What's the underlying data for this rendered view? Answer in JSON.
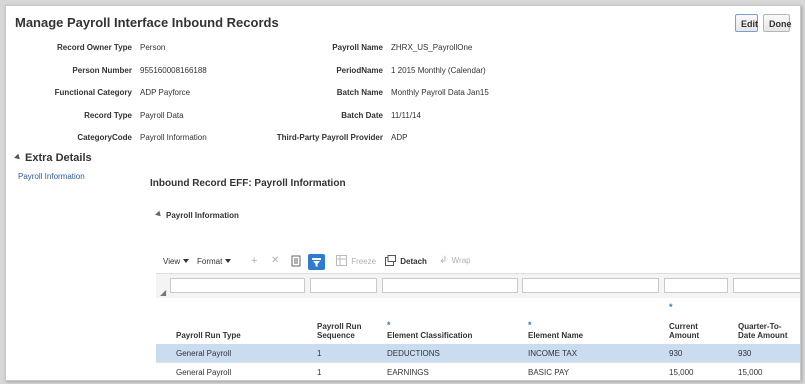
{
  "page": {
    "title": "Manage Payroll Interface Inbound Records",
    "edit_label": "Edit",
    "done_label": "Done"
  },
  "left_fields": [
    {
      "label": "Record Owner Type",
      "value": "Person"
    },
    {
      "label": "Person Number",
      "value": "955160008166188"
    },
    {
      "label": "Functional Category",
      "value": "ADP Payforce"
    },
    {
      "label": "Record Type",
      "value": "Payroll Data"
    },
    {
      "label": "CategoryCode",
      "value": "Payroll Information"
    }
  ],
  "right_fields": [
    {
      "label": "Payroll Name",
      "value": "ZHRX_US_PayrollOne"
    },
    {
      "label": "PeriodName",
      "value": "1 2015 Monthly (Calendar)"
    },
    {
      "label": "Batch Name",
      "value": "Monthly Payroll Data Jan15"
    },
    {
      "label": "Batch Date",
      "value": "11/11/14"
    },
    {
      "label": "Third-Party Payroll Provider",
      "value": "ADP"
    }
  ],
  "extra": {
    "header": "Extra Details",
    "link": "Payroll Information",
    "eff_title": "Inbound Record EFF: Payroll Information",
    "sub_header": "Payroll Information"
  },
  "toolbar": {
    "view": "View",
    "format": "Format",
    "freeze": "Freeze",
    "detach": "Detach",
    "wrap": "Wrap"
  },
  "table": {
    "columns": [
      {
        "label1": "Payroll Run Type",
        "label2": "",
        "required": false
      },
      {
        "label1": "Payroll Run",
        "label2": "Sequence",
        "required": false
      },
      {
        "label1": "Element Classification",
        "label2": "",
        "required": true
      },
      {
        "label1": "Element Name",
        "label2": "",
        "required": true
      },
      {
        "label1": "Current",
        "label2": "Amount",
        "required": true
      },
      {
        "label1": "Quarter-To-",
        "label2": "Date Amount",
        "required": false
      }
    ],
    "rows": [
      {
        "cells": [
          "General Payroll",
          "1",
          "DEDUCTIONS",
          "INCOME TAX",
          "930",
          "930"
        ],
        "selected": true
      },
      {
        "cells": [
          "General Payroll",
          "1",
          "EARNINGS",
          "BASIC PAY",
          "15,000",
          "15,000"
        ],
        "selected": false
      }
    ]
  }
}
